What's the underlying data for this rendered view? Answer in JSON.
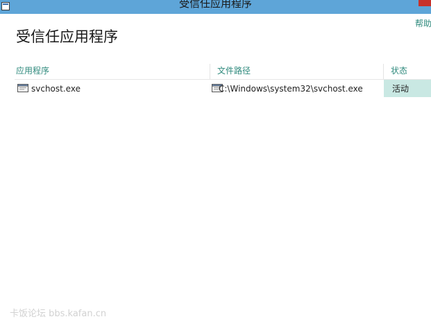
{
  "window": {
    "title": "受信任应用程序",
    "icon": "app-window-icon"
  },
  "header": {
    "title": "受信任应用程序",
    "help_label": "帮助"
  },
  "table": {
    "columns": [
      "应用程序",
      "文件路径",
      "状态"
    ],
    "rows": [
      {
        "icon": "exe-file-icon",
        "app": "svchost.exe",
        "path": "C:\\Windows\\system32\\svchost.exe",
        "status": "活动"
      }
    ]
  },
  "watermark": "卡饭论坛 bbs.kafan.cn",
  "colors": {
    "titlebar": "#5ea5d8",
    "accent": "#2f8a7d",
    "status_bg": "#c9e8e3",
    "close": "#c7322b"
  }
}
